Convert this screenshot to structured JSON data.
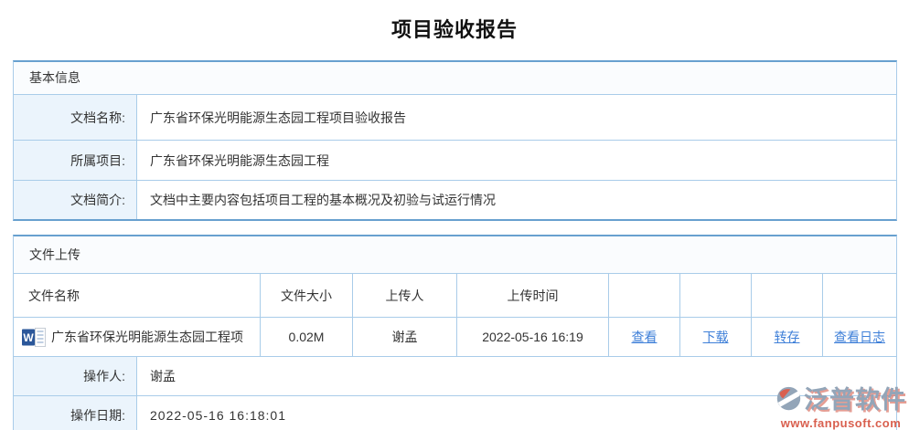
{
  "page": {
    "title": "项目验收报告"
  },
  "basic_info": {
    "section_title": "基本信息",
    "rows": [
      {
        "label": "文档名称:",
        "value": "广东省环保光明能源生态园工程项目验收报告"
      },
      {
        "label": "所属项目:",
        "value": "广东省环保光明能源生态园工程"
      },
      {
        "label": "文档简介:",
        "value": "文档中主要内容包括项目工程的基本概况及初验与试运行情况"
      }
    ]
  },
  "file_upload": {
    "section_title": "文件上传",
    "columns": {
      "name": "文件名称",
      "size": "文件大小",
      "uploader": "上传人",
      "time": "上传时间"
    },
    "file": {
      "icon": "word-file-icon",
      "name": "广东省环保光明能源生态园工程项",
      "size": "0.02M",
      "uploader": "谢孟",
      "upload_time": "2022-05-16 16:19",
      "actions": [
        "查看",
        "下载",
        "转存",
        "查看日志"
      ]
    },
    "operator": {
      "label": "操作人:",
      "value": "谢孟"
    },
    "operation_date": {
      "label": "操作日期:",
      "value": "2022-05-16 16:18:01"
    }
  },
  "watermark": {
    "brand": "泛普软件",
    "url": "www.fanpusoft.com"
  },
  "colors": {
    "border_light": "#a9cce9",
    "border_strong": "#68a0cf",
    "label_bg": "#ebf4fc",
    "link": "#3e7fd8",
    "word_icon_blue": "#2b579a",
    "watermark_gray": "#93a5b8",
    "watermark_red": "#d9604f"
  }
}
